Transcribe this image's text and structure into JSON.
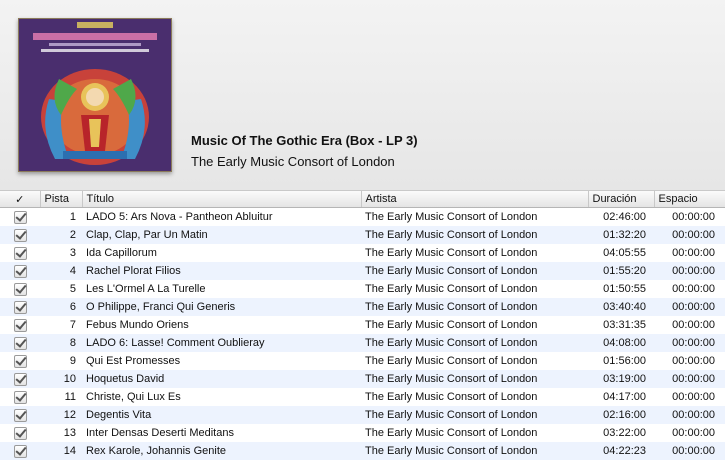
{
  "album": {
    "title": "Music Of The Gothic Era (Box - LP 3)",
    "artist": "The Early Music Consort of London",
    "cover_icon": "album-artwork"
  },
  "columns": {
    "check": "✓",
    "pista": "Pista",
    "titulo": "Título",
    "artista": "Artista",
    "duracion": "Duración",
    "espacio": "Espacio"
  },
  "tracks": [
    {
      "num": "1",
      "title": "LADO 5: Ars Nova - Pantheon Abluitur",
      "artist": "The Early Music Consort of London",
      "duration": "02:46:00",
      "space": "00:00:00",
      "checked": true
    },
    {
      "num": "2",
      "title": "Clap, Clap, Par Un Matin",
      "artist": "The Early Music Consort of London",
      "duration": "01:32:20",
      "space": "00:00:00",
      "checked": true
    },
    {
      "num": "3",
      "title": "Ida Capillorum",
      "artist": "The Early Music Consort of London",
      "duration": "04:05:55",
      "space": "00:00:00",
      "checked": true
    },
    {
      "num": "4",
      "title": "Rachel Plorat Filios",
      "artist": "The Early Music Consort of London",
      "duration": "01:55:20",
      "space": "00:00:00",
      "checked": true
    },
    {
      "num": "5",
      "title": "Les L'Ormel A La Turelle",
      "artist": "The Early Music Consort of London",
      "duration": "01:50:55",
      "space": "00:00:00",
      "checked": true
    },
    {
      "num": "6",
      "title": "O Philippe, Franci Qui Generis",
      "artist": "The Early Music Consort of London",
      "duration": "03:40:40",
      "space": "00:00:00",
      "checked": true
    },
    {
      "num": "7",
      "title": "Febus Mundo Oriens",
      "artist": "The Early Music Consort of London",
      "duration": "03:31:35",
      "space": "00:00:00",
      "checked": true
    },
    {
      "num": "8",
      "title": "LADO 6: Lasse! Comment Oublieray",
      "artist": "The Early Music Consort of London",
      "duration": "04:08:00",
      "space": "00:00:00",
      "checked": true
    },
    {
      "num": "9",
      "title": "Qui Est Promesses",
      "artist": "The Early Music Consort of London",
      "duration": "01:56:00",
      "space": "00:00:00",
      "checked": true
    },
    {
      "num": "10",
      "title": "Hoquetus David",
      "artist": "The Early Music Consort of London",
      "duration": "03:19:00",
      "space": "00:00:00",
      "checked": true
    },
    {
      "num": "11",
      "title": "Christe, Qui Lux Es",
      "artist": "The Early Music Consort of London",
      "duration": "04:17:00",
      "space": "00:00:00",
      "checked": true
    },
    {
      "num": "12",
      "title": "Degentis Vita",
      "artist": "The Early Music Consort of London",
      "duration": "02:16:00",
      "space": "00:00:00",
      "checked": true
    },
    {
      "num": "13",
      "title": "Inter Densas Deserti Meditans",
      "artist": "The Early Music Consort of London",
      "duration": "03:22:00",
      "space": "00:00:00",
      "checked": true
    },
    {
      "num": "14",
      "title": "Rex Karole, Johannis Genite",
      "artist": "The Early Music Consort of London",
      "duration": "04:22:23",
      "space": "00:00:00",
      "checked": true
    }
  ]
}
